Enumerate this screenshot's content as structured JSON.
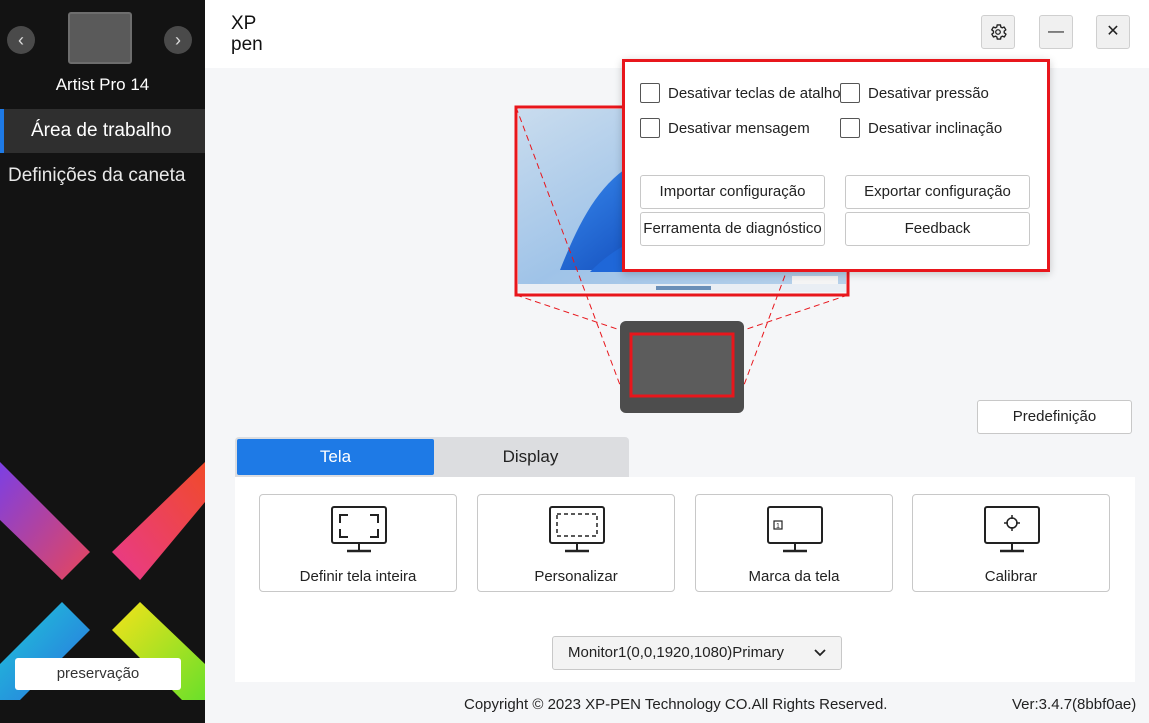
{
  "sidebar": {
    "device_name": "Artist Pro 14",
    "prev_label": "‹",
    "next_label": "›",
    "items": [
      {
        "label": "Área de trabalho"
      },
      {
        "label": "Definições da caneta"
      }
    ],
    "preserve_label": "preservação"
  },
  "header": {
    "logo_line1": "XP",
    "logo_line2": "pen",
    "settings_icon": "gear-icon",
    "minimize_label": "—",
    "close_label": "✕"
  },
  "popup": {
    "checkboxes": [
      {
        "label": "Desativar teclas de atalho",
        "checked": false
      },
      {
        "label": "Desativar pressão",
        "checked": false
      },
      {
        "label": "Desativar mensagem",
        "checked": false
      },
      {
        "label": "Desativar inclinação",
        "checked": false
      }
    ],
    "buttons": {
      "import": "Importar configuração",
      "export": "Exportar configuração",
      "diagnostic": "Ferramenta de diagnóstico",
      "feedback": "Feedback"
    }
  },
  "preset_label": "Predefinição",
  "tabs": [
    {
      "label": "Tela",
      "active": true
    },
    {
      "label": "Display",
      "active": false
    }
  ],
  "cards": [
    {
      "label": "Definir tela inteira",
      "icon": "monitor-fullscreen-icon"
    },
    {
      "label": "Personalizar",
      "icon": "monitor-custom-icon"
    },
    {
      "label": "Marca da tela",
      "icon": "monitor-mark-icon"
    },
    {
      "label": "Calibrar",
      "icon": "monitor-calibrate-icon"
    }
  ],
  "monitor_select": {
    "value": "Monitor1(0,0,1920,1080)Primary"
  },
  "footer": {
    "copyright": "Copyright © 2023  XP-PEN Technology CO.All Rights Reserved.",
    "version": "Ver:3.4.7(8bbf0ae)"
  },
  "colors": {
    "accent": "#1e7ae6",
    "highlight": "#e8161c",
    "sidebar_bg": "#131313"
  }
}
